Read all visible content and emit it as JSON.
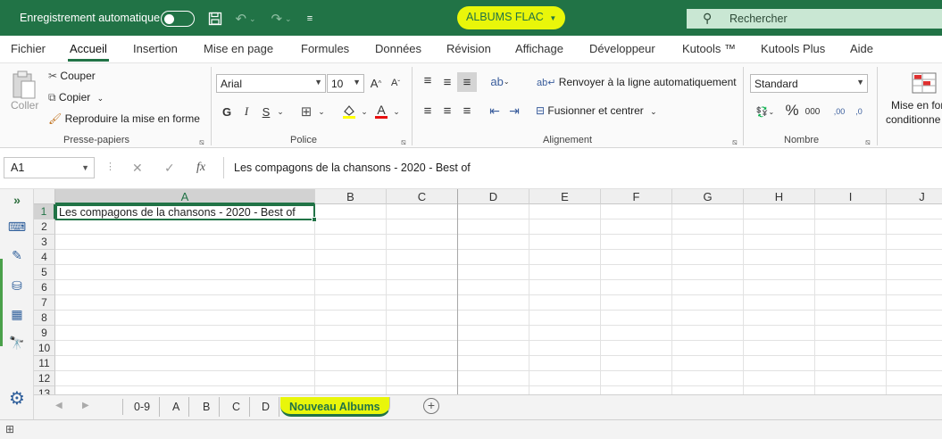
{
  "titlebar": {
    "autosave_label": "Enregistrement automatique",
    "doc_title": "ALBUMS FLAC",
    "search_placeholder": "Rechercher",
    "icons": [
      "save-icon",
      "undo-icon",
      "redo-icon",
      "customize-qat-icon"
    ]
  },
  "menu_tabs": [
    "Fichier",
    "Accueil",
    "Insertion",
    "Mise en page",
    "Formules",
    "Données",
    "Révision",
    "Affichage",
    "Développeur",
    "Kutools ™",
    "Kutools Plus",
    "Aide"
  ],
  "active_tab": "Accueil",
  "ribbon": {
    "clipboard": {
      "label": "Presse-papiers",
      "paste": "Coller",
      "cut": "Couper",
      "copy": "Copier",
      "format_painter": "Reproduire la mise en forme"
    },
    "font": {
      "label": "Police",
      "font_name": "Arial",
      "font_size": "10",
      "bold": "G",
      "italic": "I",
      "underline": "S",
      "font_color": "A"
    },
    "alignment": {
      "label": "Alignement",
      "wrap_text": "Renvoyer à la ligne automatiquement",
      "merge_center": "Fusionner et centrer"
    },
    "number": {
      "label": "Nombre",
      "format": "Standard",
      "percent": "%",
      "thousands": "000",
      "dec_increase": ",00",
      "dec_decrease": ",0"
    },
    "styles": {
      "conditional_formatting_line1": "Mise en for",
      "conditional_formatting_line2": "conditionne"
    }
  },
  "formula_bar": {
    "name_box": "A1",
    "fx": "fx",
    "content": "Les compagons de la chansons - 2020 - Best of"
  },
  "grid": {
    "columns": [
      "A",
      "B",
      "C",
      "D",
      "E",
      "F",
      "G",
      "H",
      "I",
      "J"
    ],
    "rows": [
      "1",
      "2",
      "3",
      "4",
      "5",
      "6",
      "7",
      "8",
      "9",
      "10",
      "11",
      "12",
      "13"
    ],
    "cells": {
      "A1": "Les compagons de la chansons - 2020 - Best of"
    },
    "selected_cell": "A1"
  },
  "sheets": [
    "0-9",
    "A",
    "B",
    "C",
    "D",
    "Nouveau Albums"
  ],
  "active_sheet": "Nouveau Albums",
  "colors": {
    "excel_green": "#217346",
    "highlight_yellow": "#e9f60a"
  }
}
